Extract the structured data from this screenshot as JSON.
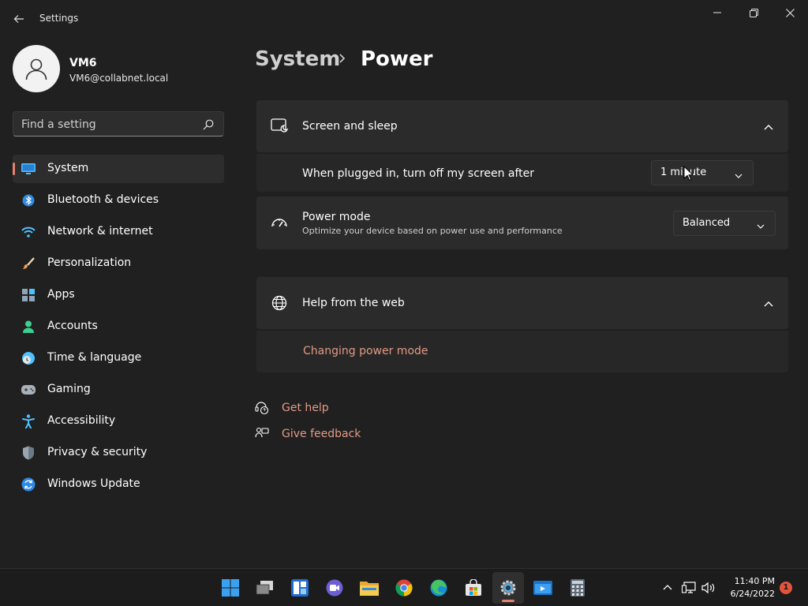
{
  "window": {
    "title": "Settings"
  },
  "user": {
    "name": "VM6",
    "email": "VM6@collabnet.local"
  },
  "search": {
    "placeholder": "Find a setting"
  },
  "sidebar": {
    "items": [
      {
        "label": "System",
        "icon": "system-icon",
        "selected": true
      },
      {
        "label": "Bluetooth & devices",
        "icon": "bluetooth-icon"
      },
      {
        "label": "Network & internet",
        "icon": "wifi-icon"
      },
      {
        "label": "Personalization",
        "icon": "brush-icon"
      },
      {
        "label": "Apps",
        "icon": "apps-icon"
      },
      {
        "label": "Accounts",
        "icon": "person-icon"
      },
      {
        "label": "Time & language",
        "icon": "clock-globe-icon"
      },
      {
        "label": "Gaming",
        "icon": "gamepad-icon"
      },
      {
        "label": "Accessibility",
        "icon": "accessibility-icon"
      },
      {
        "label": "Privacy & security",
        "icon": "shield-icon"
      },
      {
        "label": "Windows Update",
        "icon": "update-icon"
      }
    ]
  },
  "breadcrumb": {
    "parent": "System",
    "current": "Power"
  },
  "screen_sleep": {
    "title": "Screen and sleep",
    "plugged_label": "When plugged in, turn off my screen after",
    "plugged_value": "1 minute"
  },
  "power_mode": {
    "title": "Power mode",
    "description": "Optimize your device based on power use and performance",
    "value": "Balanced"
  },
  "help_web": {
    "title": "Help from the web",
    "link": "Changing power mode"
  },
  "footer_links": {
    "get_help": "Get help",
    "give_feedback": "Give feedback"
  },
  "taskbar": {
    "apps": [
      "start-icon",
      "task-view-icon",
      "widgets-icon",
      "chat-icon",
      "file-explorer-icon",
      "chrome-icon",
      "edge-icon",
      "store-icon",
      "settings-icon",
      "remote-desktop-icon",
      "calculator-icon"
    ],
    "time": "11:40 PM",
    "date": "6/24/2022",
    "notification_count": "1"
  },
  "colors": {
    "background": "#202020",
    "card": "#2b2b2b",
    "accent": "#e58170",
    "link": "#e39a85"
  }
}
